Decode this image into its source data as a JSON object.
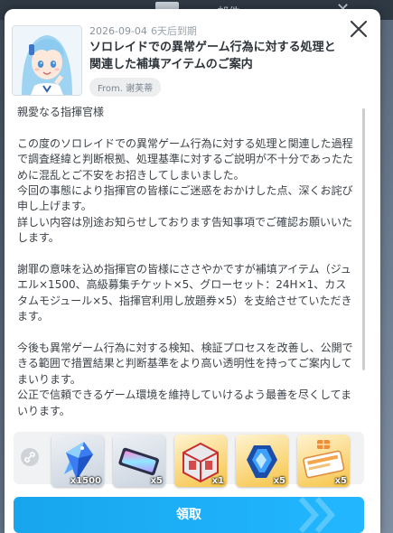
{
  "background": {
    "title": "邮件",
    "close_glyph": "✕"
  },
  "mail": {
    "date": "2026-09-04",
    "expire": "6天后到期",
    "title": "ソロレイドでの異常ゲーム行為に対する処理と関連した補填アイテムのご案内",
    "from": "From. 谢芙蒂",
    "greeting": "親愛なる指揮官様",
    "paragraphs": [
      "この度のソロレイドでの異常ゲーム行為に対する処理と関連した過程で調査経緯と判断根拠、処理基準に対するご説明が不十分であったために混乱とご不安をお招きしてしまいました。\n今回の事態により指揮官の皆様にご迷惑をおかけした点、深くお詫び申し上げます。\n詳しい内容は別途お知らせしております告知事項でご確認お願いいたします。",
      "謝罪の意味を込め指揮官の皆様にささやかですが補填アイテム（ジュエル×1500、高級募集チケット×5、グローセット：24H×1、カスタムモジュール×5、指揮官利用し放題券×5）を支給させていただきます。",
      "今後も異常ゲーム行為に対する検知、検証プロセスを改善し、公開できる範囲で措置結果と判断基準をより高い透明性を持ってご案内してまいります。\n公正で信頼できるゲーム環境を維持していけるよう最善を尽くしてまいります。"
    ]
  },
  "rewards": [
    {
      "icon": "jewel-icon",
      "qty": "x1500"
    },
    {
      "icon": "recruit-ticket-icon",
      "qty": "x5"
    },
    {
      "icon": "gear-box-icon",
      "qty": "x1"
    },
    {
      "icon": "custom-module-icon",
      "qty": "x5"
    },
    {
      "icon": "free-use-ticket-icon",
      "qty": "x5"
    }
  ],
  "claim_button": {
    "label": "領取"
  },
  "colors": {
    "accent": "#1ea9f2",
    "text": "#3b4147",
    "gold_frame": "#f6c447"
  }
}
